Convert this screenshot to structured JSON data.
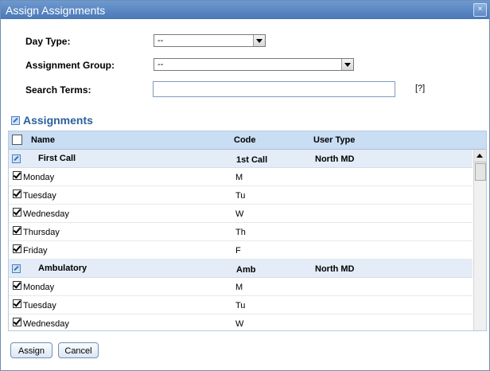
{
  "window": {
    "title": "Assign Assignments",
    "close_label": "×"
  },
  "form": {
    "day_type": {
      "label": "Day Type:",
      "value": "--"
    },
    "assignment_group": {
      "label": "Assignment Group:",
      "value": "--"
    },
    "search_terms": {
      "label": "Search Terms:",
      "value": "",
      "help": "[?]"
    }
  },
  "assignments": {
    "section_title": "Assignments",
    "columns": {
      "name": "Name",
      "code": "Code",
      "user_type": "User Type"
    },
    "rows": [
      {
        "kind": "group",
        "name": "First Call",
        "code": "1st Call",
        "user_type": "North MD"
      },
      {
        "kind": "item",
        "name": "Monday",
        "code": "M",
        "checked": true
      },
      {
        "kind": "item",
        "name": "Tuesday",
        "code": "Tu",
        "checked": true
      },
      {
        "kind": "item",
        "name": "Wednesday",
        "code": "W",
        "checked": true
      },
      {
        "kind": "item",
        "name": "Thursday",
        "code": "Th",
        "checked": true
      },
      {
        "kind": "item",
        "name": "Friday",
        "code": "F",
        "checked": true
      },
      {
        "kind": "group",
        "name": "Ambulatory",
        "code": "Amb",
        "user_type": "North MD"
      },
      {
        "kind": "item",
        "name": "Monday",
        "code": "M",
        "checked": true
      },
      {
        "kind": "item",
        "name": "Tuesday",
        "code": "Tu",
        "checked": true
      },
      {
        "kind": "item",
        "name": "Wednesday",
        "code": "W",
        "checked": true
      }
    ]
  },
  "buttons": {
    "assign": "Assign",
    "cancel": "Cancel"
  },
  "colors": {
    "titlebar": "#5a88c4",
    "header_bg": "#c9ddf3",
    "group_bg": "#e4ecf7",
    "section_title": "#2d5f9c"
  }
}
